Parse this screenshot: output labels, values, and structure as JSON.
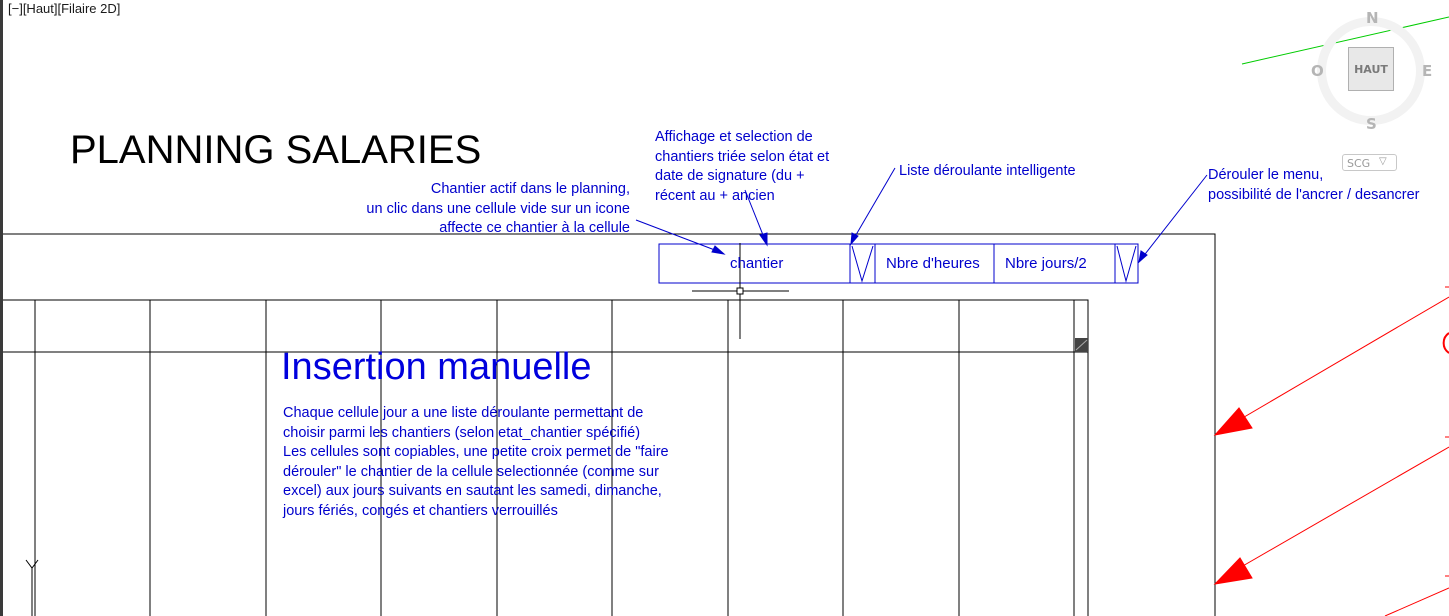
{
  "viewport": {
    "label": "[−][Haut][Filaire 2D]"
  },
  "drawing": {
    "title": "PLANNING SALARIES",
    "header_cells": {
      "chantier": "chantier",
      "heures": "Nbre d'heures",
      "jours": "Nbre jours/2"
    },
    "section_title": "Insertion manuelle",
    "ucs_y_label": "Y"
  },
  "annotations": {
    "chantier_actif": [
      "Chantier actif dans le planning,",
      "un clic dans une cellule vide sur un icone",
      "affecte ce chantier à la cellule"
    ],
    "affichage": [
      "Affichage et selection de",
      "chantiers triée selon état et",
      "date de signature (du +",
      "récent au + ancien"
    ],
    "liste": [
      "Liste déroulante intelligente"
    ],
    "derouler": [
      "Dérouler le menu,",
      "possibilité de l'ancrer / desancrer"
    ],
    "insertion": [
      "Chaque cellule jour a une liste déroulante permettant de",
      "choisir parmi les chantiers (selon etat_chantier spécifié)",
      "Les cellules sont copiables, une petite croix permet de \"faire",
      "dérouler\" le chantier de la cellule selectionnée (comme sur",
      "excel) aux jours suivants en sautant les samedi, dimanche,",
      "jours fériés, congés et chantiers verrouillés"
    ]
  },
  "viewcube": {
    "north": "N",
    "south": "S",
    "west": "O",
    "east": "E",
    "face": "HAUT",
    "ucs": "SCG"
  },
  "colors": {
    "annotation": "#0000cc",
    "leader_red": "#ff0000",
    "green_line": "#00cc00",
    "frame": "#000000"
  }
}
